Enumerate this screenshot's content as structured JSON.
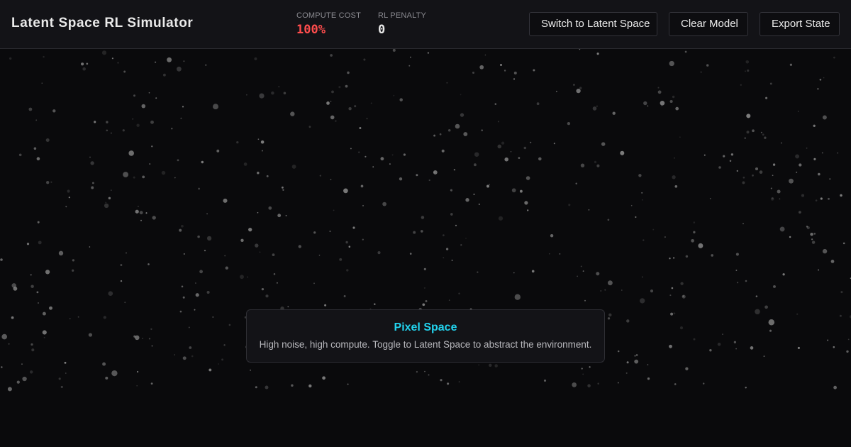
{
  "header": {
    "title": "Latent Space RL Simulator",
    "stats": {
      "compute_cost": {
        "label": "COMPUTE COST",
        "value": "100%",
        "color": "#ff4d4d"
      },
      "rl_penalty": {
        "label": "RL PENALTY",
        "value": "0",
        "color": "#e8e8e8"
      }
    },
    "buttons": {
      "switch_label": "Switch to Latent Space",
      "clear_label": "Clear Model",
      "export_label": "Export State"
    }
  },
  "info": {
    "title": "Pixel Space",
    "title_color": "#22d3ee",
    "description": "High noise, high compute. Toggle to Latent Space to abstract the environment."
  },
  "stage": {
    "mode": "pixel-space-noise",
    "particle_color": "#9a9a9a"
  }
}
